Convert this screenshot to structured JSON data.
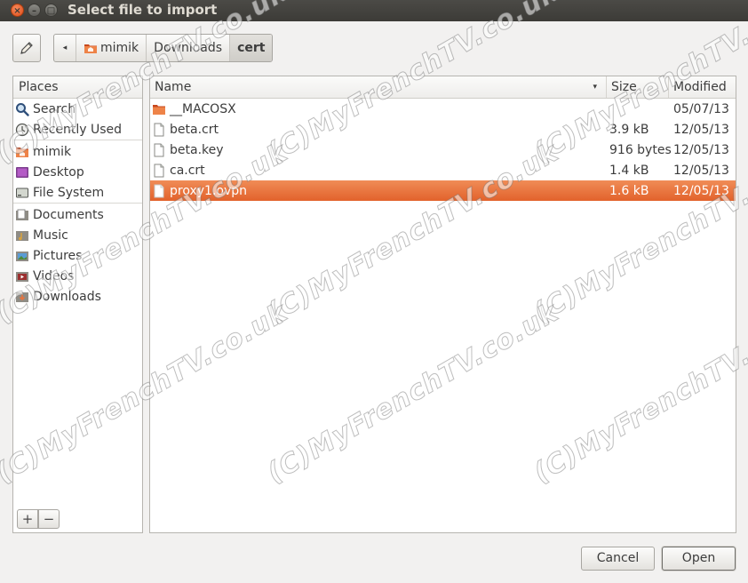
{
  "window": {
    "title": "Select file to import",
    "close_glyph": "×",
    "min_glyph": "–",
    "max_glyph": "□"
  },
  "toolbar": {
    "edit_icon": "pencil-icon",
    "path_arrow": "◂",
    "path": [
      "mimik",
      "Downloads",
      "cert"
    ],
    "active_path_index": 2
  },
  "places": {
    "header": "Places",
    "items": [
      {
        "label": "Search",
        "icon": "search-icon"
      },
      {
        "label": "Recently Used",
        "icon": "recent-icon"
      },
      {
        "label": "mimik",
        "icon": "home-folder-icon"
      },
      {
        "label": "Desktop",
        "icon": "desktop-icon"
      },
      {
        "label": "File System",
        "icon": "drive-icon"
      },
      {
        "label": "Documents",
        "icon": "documents-icon"
      },
      {
        "label": "Music",
        "icon": "music-icon"
      },
      {
        "label": "Pictures",
        "icon": "pictures-icon"
      },
      {
        "label": "Videos",
        "icon": "videos-icon"
      },
      {
        "label": "Downloads",
        "icon": "downloads-icon"
      }
    ],
    "add_label": "+",
    "remove_label": "−"
  },
  "files": {
    "columns": {
      "name": "Name",
      "size": "Size",
      "modified": "Modified"
    },
    "sort_glyph": "▾",
    "rows": [
      {
        "name": "__MACOSX",
        "size": "",
        "modified": "05/07/13",
        "type": "folder"
      },
      {
        "name": "beta.crt",
        "size": "3.9 kB",
        "modified": "12/05/13",
        "type": "file"
      },
      {
        "name": "beta.key",
        "size": "916 bytes",
        "modified": "12/05/13",
        "type": "file"
      },
      {
        "name": "ca.crt",
        "size": "1.4 kB",
        "modified": "12/05/13",
        "type": "file"
      },
      {
        "name": "proxy1.ovpn",
        "size": "1.6 kB",
        "modified": "12/05/13",
        "type": "file"
      }
    ],
    "selected_index": 4
  },
  "buttons": {
    "cancel": "Cancel",
    "open": "Open"
  },
  "watermark": {
    "text": "(C)MyFrenchTV.co.uk"
  },
  "colors": {
    "accent": "#e2622b",
    "folder": "#e8733d"
  }
}
